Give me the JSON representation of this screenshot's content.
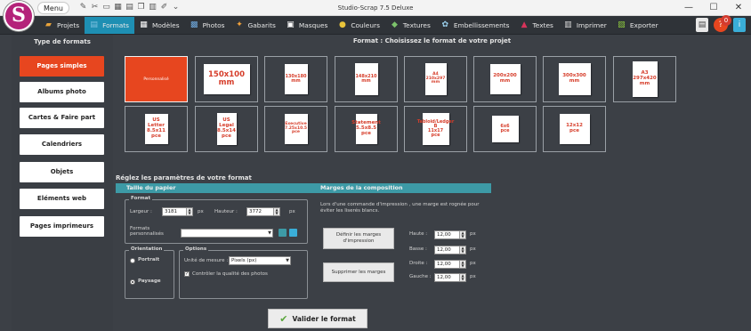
{
  "window": {
    "title": "Studio-Scrap 7.5 Deluxe",
    "menu_label": "Menu",
    "minimize": "—",
    "maximize": "☐",
    "close": "✕",
    "logo_letter": "S"
  },
  "nav": {
    "items": [
      {
        "label": "Projets",
        "icon": "folder-icon",
        "glyph": "▰",
        "color": "#e8a33a"
      },
      {
        "label": "Formats",
        "icon": "formats-icon",
        "glyph": "▤",
        "color": "#7ec1e0",
        "active": true
      },
      {
        "label": "Modèles",
        "icon": "templates-icon",
        "glyph": "▦",
        "color": "#ffffff"
      },
      {
        "label": "Photos",
        "icon": "photos-icon",
        "glyph": "▩",
        "color": "#6fa8dc"
      },
      {
        "label": "Gabarits",
        "icon": "gabarits-icon",
        "glyph": "✦",
        "color": "#f3a33b"
      },
      {
        "label": "Masques",
        "icon": "masks-icon",
        "glyph": "▣",
        "color": "#ffffff"
      },
      {
        "label": "Couleurs",
        "icon": "colors-icon",
        "glyph": "●",
        "color": "#e9c43a"
      },
      {
        "label": "Textures",
        "icon": "textures-icon",
        "glyph": "◆",
        "color": "#7cc36b"
      },
      {
        "label": "Embellissements",
        "icon": "embellishments-icon",
        "glyph": "✿",
        "color": "#9cd2ef"
      },
      {
        "label": "Textes",
        "icon": "text-icon",
        "glyph": "▲",
        "color": "#d8335a"
      },
      {
        "label": "Imprimer",
        "icon": "print-icon",
        "glyph": "▥",
        "color": "#dcdcdc"
      },
      {
        "label": "Exporter",
        "icon": "export-icon",
        "glyph": "▧",
        "color": "#8cc63f"
      }
    ],
    "notification_count": "0"
  },
  "sidebar": {
    "title": "Type de formats",
    "items": [
      {
        "label": "Pages simples",
        "active": true
      },
      {
        "label": "Albums photo"
      },
      {
        "label": "Cartes & Faire part"
      },
      {
        "label": "Calendriers"
      },
      {
        "label": "Objets"
      },
      {
        "label": "Eléments web"
      },
      {
        "label": "Pages imprimeurs"
      }
    ]
  },
  "formats": {
    "title": "Format : Choisissez le format de votre projet",
    "row1": [
      {
        "label": "Personnalisé",
        "custom": true
      },
      {
        "label": "150x100\nmm"
      },
      {
        "label": "130x180\nmm"
      },
      {
        "label": "148x210\nmm"
      },
      {
        "label": "A4\n210x297\nmm"
      },
      {
        "label": "200x200\nmm"
      },
      {
        "label": "300x300\nmm"
      },
      {
        "label": "A3\n297x420\nmm"
      }
    ],
    "row2": [
      {
        "label": "US Letter\n8.5x11\npce"
      },
      {
        "label": "US Legal\n8.5x14\npce"
      },
      {
        "label": "Executive\n7.25x10.5\npce"
      },
      {
        "label": "Statement\n5.5x8.5\npce"
      },
      {
        "label": "Tabloid/Ledger B\n11x17\npce"
      },
      {
        "label": "6x6\npce"
      },
      {
        "label": "12x12\npce"
      }
    ]
  },
  "settings": {
    "title": "Réglez les paramètres de votre format",
    "paper_header": "Taille du papier",
    "margin_header": "Marges de la composition",
    "format_legend": "Format",
    "width_label": "Largeur :",
    "width_value": "3181",
    "width_unit": "px",
    "height_label": "Hauteur :",
    "height_value": "3772",
    "height_unit": "px",
    "custom_formats_label": "Formats\npersonnalisés",
    "custom_formats_value": "",
    "orientation_legend": "Orientation",
    "portrait_label": "Portrait",
    "paysage_label": "Paysage",
    "options_legend": "Options",
    "unit_label": "Unité de mesure :",
    "unit_value": "Pixels (px)",
    "quality_label": "Contrôler la qualité des photos",
    "margin_text": "Lors d'une commande d'impression , une marge est rognée pour éviter les liserés blancs.",
    "define_margins": "Définir les marges\nd'impression",
    "remove_margins": "Supprimer les marges",
    "margins": [
      {
        "label": "Haute :",
        "value": "12,00",
        "unit": "px"
      },
      {
        "label": "Basse :",
        "value": "12,00",
        "unit": "px"
      },
      {
        "label": "Droite :",
        "value": "12,00",
        "unit": "px"
      },
      {
        "label": "Gauche :",
        "value": "12,00",
        "unit": "px"
      }
    ],
    "validate_label": "Valider le format"
  }
}
